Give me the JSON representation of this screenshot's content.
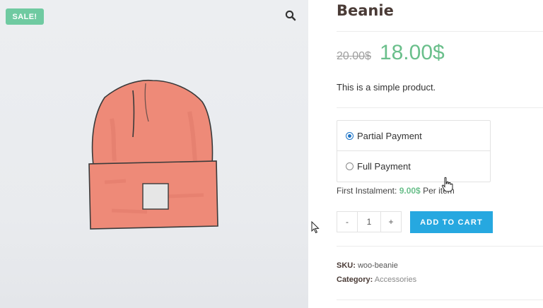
{
  "gallery": {
    "sale_badge": "SALE!",
    "zoom_icon": "search-icon"
  },
  "product": {
    "title": "Beanie",
    "old_price": "20.00$",
    "price": "18.00$",
    "short_description": "This is a simple product."
  },
  "payment": {
    "options": [
      {
        "label": "Partial Payment",
        "selected": true
      },
      {
        "label": "Full Payment",
        "selected": false
      }
    ],
    "instalment_label": "First Instalment:",
    "instalment_amount": "9.00$",
    "instalment_suffix": "Per item"
  },
  "cart": {
    "minus": "-",
    "quantity": "1",
    "plus": "+",
    "add_to_cart": "ADD TO CART"
  },
  "meta": {
    "sku_label": "SKU:",
    "sku": "woo-beanie",
    "category_label": "Category:",
    "category": "Accessories"
  },
  "colors": {
    "sale_badge": "#6fcaa1",
    "price": "#6abf8b",
    "button": "#26a8e0",
    "hat": "#ee8a78"
  }
}
